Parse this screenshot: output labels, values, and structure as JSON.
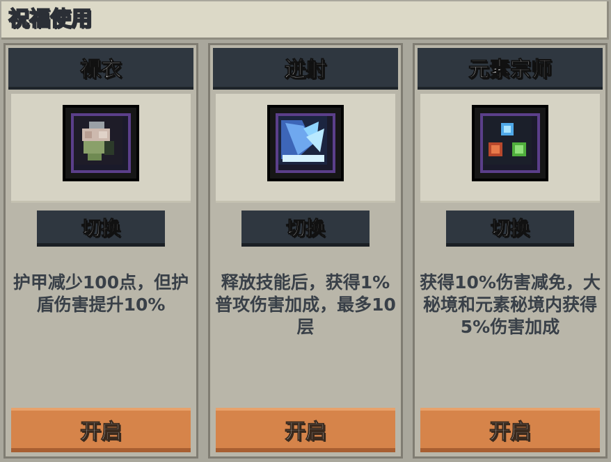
{
  "header": {
    "title": "祝福使用"
  },
  "cards": [
    {
      "name": "裸衣",
      "icon": "cloth-armor-icon",
      "switch_label": "切换",
      "description": "护甲减少100点，但护盾伤害提升10%",
      "open_label": "开启"
    },
    {
      "name": "迸射",
      "icon": "burst-shot-icon",
      "switch_label": "切换",
      "description": "释放技能后，获得1%普攻伤害加成，最多10层",
      "open_label": "开启"
    },
    {
      "name": "元素宗师",
      "icon": "element-orbs-icon",
      "switch_label": "切换",
      "description": "获得10%伤害减免，大秘境和元素秘境内获得5%伤害加成",
      "open_label": "开启"
    }
  ],
  "colors": {
    "header_dark": "#2f3740",
    "open_button": "#d6844a",
    "text_dark": "#394048",
    "icon_border": "#5b3f8a"
  }
}
